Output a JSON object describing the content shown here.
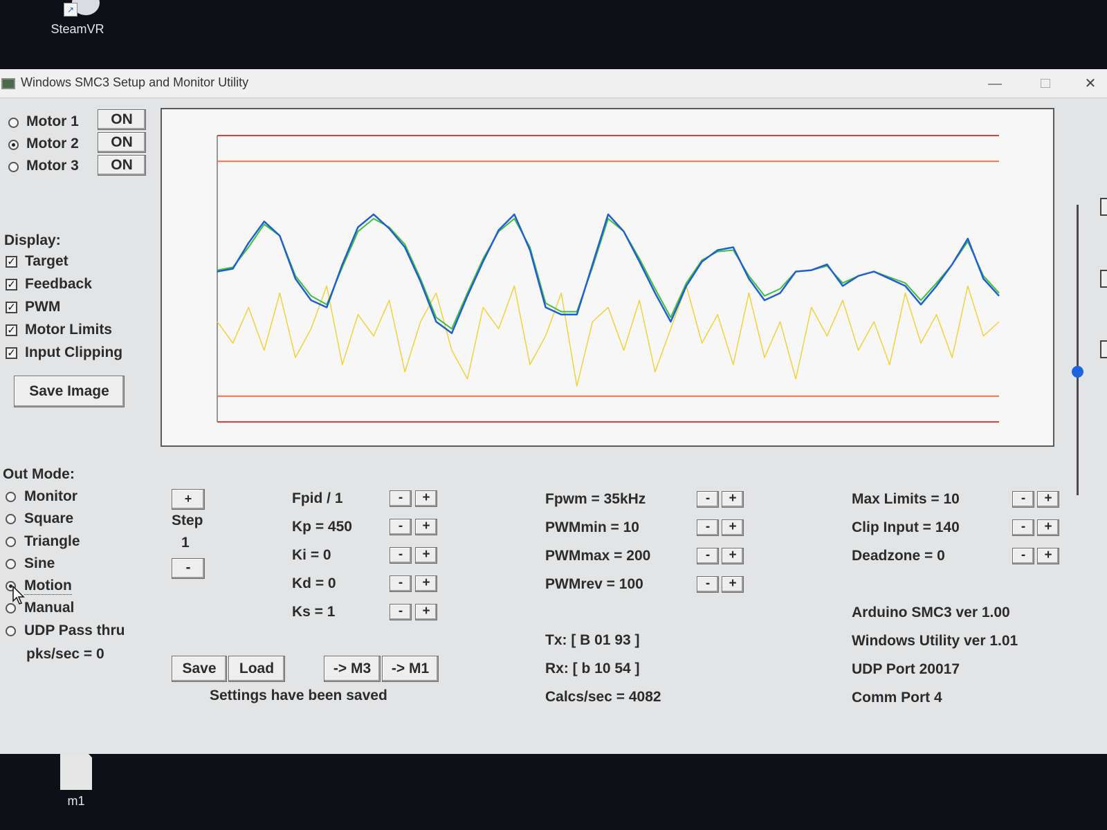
{
  "desktop": {
    "top_icon_label": "SteamVR",
    "bottom_icon_label": "m1"
  },
  "window": {
    "title": "Windows SMC3 Setup and Monitor Utility",
    "minimize_glyph": "—",
    "close_glyph": "✕"
  },
  "motors": [
    {
      "label": "Motor 1",
      "state": "ON",
      "selected": false
    },
    {
      "label": "Motor 2",
      "state": "ON",
      "selected": true
    },
    {
      "label": "Motor 3",
      "state": "ON",
      "selected": false
    }
  ],
  "display": {
    "heading": "Display:",
    "options": [
      {
        "label": "Target",
        "checked": true
      },
      {
        "label": "Feedback",
        "checked": true
      },
      {
        "label": "PWM",
        "checked": true
      },
      {
        "label": "Motor Limits",
        "checked": true
      },
      {
        "label": "Input Clipping",
        "checked": true
      }
    ],
    "save_image": "Save Image"
  },
  "out_mode": {
    "heading": "Out Mode:",
    "options": [
      {
        "label": "Monitor",
        "selected": false
      },
      {
        "label": "Square",
        "selected": false
      },
      {
        "label": "Triangle",
        "selected": false
      },
      {
        "label": "Sine",
        "selected": false
      },
      {
        "label": "Motion",
        "selected": true
      },
      {
        "label": "Manual",
        "selected": false
      },
      {
        "label": "UDP Pass thru",
        "selected": false
      }
    ],
    "pks_sec": "pks/sec = 0"
  },
  "step": {
    "plus": "+",
    "label": "Step",
    "value": "1",
    "minus": "-"
  },
  "pid_params": [
    "Fpid / 1",
    "Kp = 450",
    "Ki = 0",
    "Kd = 0",
    "Ks = 1"
  ],
  "pwm_params": [
    "Fpwm = 35kHz",
    "PWMmin = 10",
    "PWMmax = 200",
    "PWMrev = 100"
  ],
  "limit_params": [
    "Max Limits = 10",
    "Clip Input = 140",
    "Deadzone = 0"
  ],
  "adjust": {
    "minus": "-",
    "plus": "+"
  },
  "buttons": {
    "save": "Save",
    "load": "Load",
    "to_m3": "-> M3",
    "to_m1": "-> M1"
  },
  "status": {
    "settings_msg": "Settings have been saved",
    "tx": "Tx: [ B 01 93 ]",
    "rx": "Rx: [ b 10 54 ]",
    "calcs": "Calcs/sec = 4082"
  },
  "info": [
    "Arduino SMC3 ver 1.00",
    "Windows Utility ver 1.01",
    "UDP Port 20017",
    "Comm Port 4"
  ],
  "chart_data": {
    "type": "line",
    "y_range": [
      -1,
      1
    ],
    "colors": {
      "target": "#3fbf3f",
      "feedback": "#1f5fd0",
      "pwm": "#f0d23a",
      "limits": "#e8734a",
      "clip": "#e03c3c"
    },
    "limit_lines": [
      0.82,
      -0.82
    ],
    "clip_lines": [
      1.0,
      -1.0
    ],
    "x": [
      0,
      0.02,
      0.04,
      0.06,
      0.08,
      0.1,
      0.12,
      0.14,
      0.16,
      0.18,
      0.2,
      0.22,
      0.24,
      0.26,
      0.28,
      0.3,
      0.32,
      0.34,
      0.36,
      0.38,
      0.4,
      0.42,
      0.44,
      0.46,
      0.48,
      0.5,
      0.52,
      0.54,
      0.56,
      0.58,
      0.6,
      0.62,
      0.64,
      0.66,
      0.68,
      0.7,
      0.72,
      0.74,
      0.76,
      0.78,
      0.8,
      0.82,
      0.84,
      0.86,
      0.88,
      0.9,
      0.92,
      0.94,
      0.96,
      0.98,
      1.0
    ],
    "feedback": [
      0.05,
      0.07,
      0.25,
      0.4,
      0.3,
      0.0,
      -0.15,
      -0.2,
      0.1,
      0.36,
      0.45,
      0.35,
      0.22,
      -0.02,
      -0.3,
      -0.38,
      -0.12,
      0.12,
      0.34,
      0.45,
      0.2,
      -0.2,
      -0.25,
      -0.25,
      0.1,
      0.45,
      0.33,
      0.12,
      -0.1,
      -0.3,
      -0.05,
      0.12,
      0.2,
      0.22,
      0.0,
      -0.15,
      -0.1,
      0.05,
      0.06,
      0.1,
      -0.05,
      0.02,
      0.05,
      0.0,
      -0.05,
      -0.18,
      -0.05,
      0.1,
      0.28,
      0.0,
      -0.12
    ],
    "target": [
      0.06,
      0.08,
      0.22,
      0.38,
      0.3,
      0.02,
      -0.12,
      -0.18,
      0.08,
      0.33,
      0.42,
      0.36,
      0.24,
      0.0,
      -0.27,
      -0.35,
      -0.1,
      0.14,
      0.33,
      0.42,
      0.22,
      -0.17,
      -0.23,
      -0.23,
      0.08,
      0.42,
      0.33,
      0.14,
      -0.07,
      -0.27,
      -0.03,
      0.13,
      0.19,
      0.2,
      0.02,
      -0.12,
      -0.07,
      0.05,
      0.06,
      0.09,
      -0.03,
      0.02,
      0.05,
      0.01,
      -0.03,
      -0.15,
      -0.03,
      0.1,
      0.26,
      0.02,
      -0.1
    ],
    "pwm": [
      -0.3,
      -0.45,
      -0.2,
      -0.5,
      -0.1,
      -0.55,
      -0.35,
      -0.05,
      -0.6,
      -0.25,
      -0.4,
      -0.15,
      -0.65,
      -0.3,
      -0.1,
      -0.5,
      -0.7,
      -0.2,
      -0.35,
      -0.05,
      -0.6,
      -0.4,
      -0.1,
      -0.75,
      -0.3,
      -0.2,
      -0.5,
      -0.15,
      -0.65,
      -0.35,
      -0.05,
      -0.45,
      -0.25,
      -0.6,
      -0.1,
      -0.55,
      -0.3,
      -0.7,
      -0.2,
      -0.4,
      -0.15,
      -0.5,
      -0.3,
      -0.6,
      -0.1,
      -0.45,
      -0.25,
      -0.55,
      -0.05,
      -0.4,
      -0.3
    ]
  }
}
